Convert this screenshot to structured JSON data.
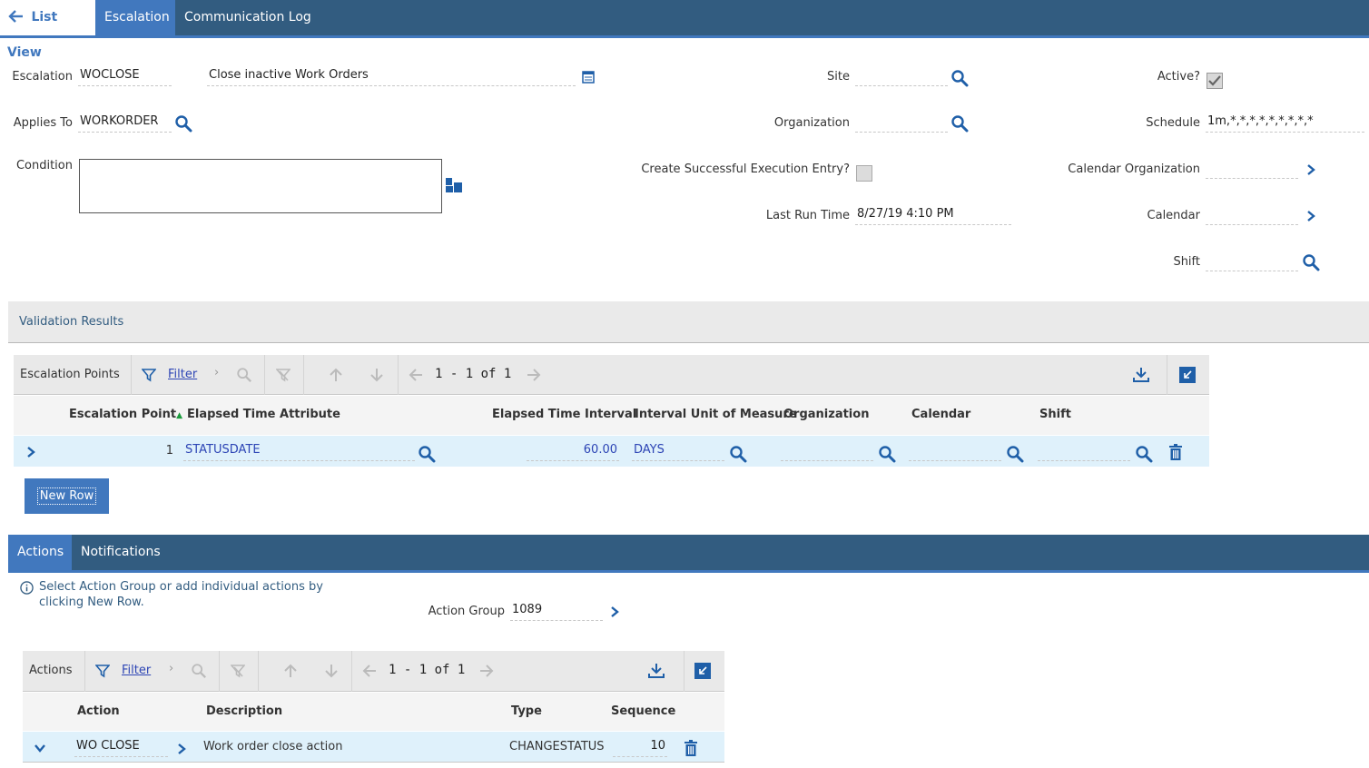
{
  "tabs": {
    "list_view": "List View",
    "escalation": "Escalation",
    "communication_log": "Communication Log"
  },
  "header": {
    "escalation_label": "Escalation",
    "escalation_value": "WOCLOSE",
    "description_value": "Close inactive Work Orders",
    "site_label": "Site",
    "site_value": "",
    "active_label": "Active?",
    "active_checked": true,
    "applies_to_label": "Applies To",
    "applies_to_value": "WORKORDER",
    "organization_label": "Organization",
    "organization_value": "",
    "schedule_label": "Schedule",
    "schedule_value": "1m,*,*,*,*,*,*,*,*,*",
    "condition_label": "Condition",
    "condition_value": "",
    "create_exec_label": "Create Successful Execution Entry?",
    "create_exec_checked": false,
    "calendar_org_label": "Calendar Organization",
    "calendar_org_value": "",
    "last_run_label": "Last Run Time",
    "last_run_value": "8/27/19 4:10 PM",
    "calendar_label": "Calendar",
    "calendar_value": "",
    "shift_label": "Shift",
    "shift_value": ""
  },
  "validation": {
    "title": "Validation Results"
  },
  "escalation_points": {
    "title": "Escalation Points",
    "filter": "Filter",
    "pager": "1 - 1 of 1",
    "columns": [
      "Escalation Point",
      "Elapsed Time Attribute",
      "Elapsed Time Interval",
      "Interval Unit of Measure",
      "Organization",
      "Calendar",
      "Shift"
    ],
    "rows": [
      {
        "point": "1",
        "attribute": "STATUSDATE",
        "interval": "60.00",
        "unit": "DAYS",
        "organization": "",
        "calendar": "",
        "shift": ""
      }
    ],
    "new_row": "New Row"
  },
  "subtabs": {
    "actions": "Actions",
    "notifications": "Notifications"
  },
  "actions_section": {
    "info_text": "Select Action Group or add individual actions by clicking New Row.",
    "action_group_label": "Action Group",
    "action_group_value": "1089"
  },
  "actions_table": {
    "title": "Actions",
    "filter": "Filter",
    "pager": "1 - 1 of 1",
    "columns": [
      "Action",
      "Description",
      "Type",
      "Sequence"
    ],
    "rows": [
      {
        "action": "WO CLOSE",
        "description": "Work order close action",
        "type": "CHANGESTATUS",
        "sequence": "10"
      }
    ]
  },
  "colors": {
    "nav_bg": "#325c80",
    "accent": "#4178be",
    "row_highlight": "#dff1fb",
    "link": "#2d45b5"
  }
}
